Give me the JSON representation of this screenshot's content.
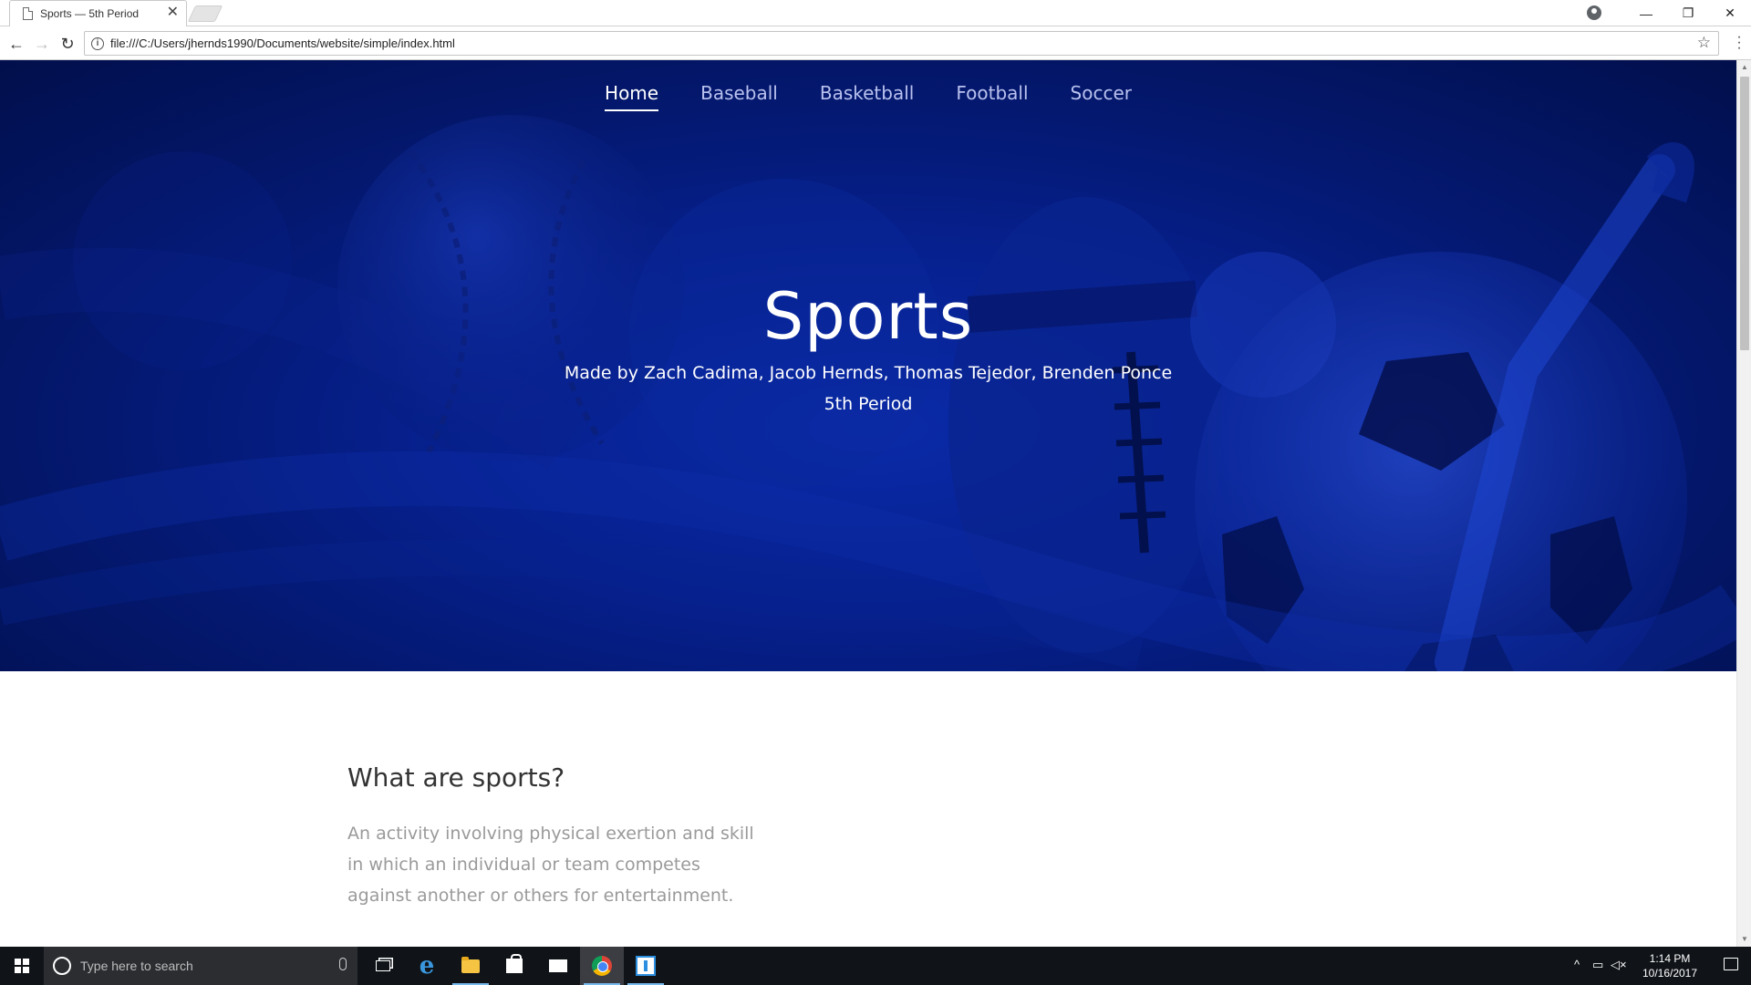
{
  "browser": {
    "tab_title": "Sports — 5th Period",
    "tab_close": "✕",
    "url": "file:///C:/Users/jhernds1990/Documents/website/simple/index.html",
    "window_controls": {
      "minimize": "—",
      "restore": "❐",
      "close": "✕"
    }
  },
  "site": {
    "nav": [
      {
        "label": "Home",
        "active": true
      },
      {
        "label": "Baseball"
      },
      {
        "label": "Basketball"
      },
      {
        "label": "Football"
      },
      {
        "label": "Soccer"
      }
    ],
    "hero": {
      "title": "Sports",
      "subtitle_line1": "Made by Zach Cadima, Jacob Hernds, Thomas Tejedor, Brenden Ponce",
      "subtitle_line2": "5th Period"
    },
    "section": {
      "heading": "What are sports?",
      "body": "An activity involving physical exertion and skill in which an individual or team competes against another or others for entertainment."
    }
  },
  "taskbar": {
    "search_placeholder": "Type here to search",
    "time": "1:14 PM",
    "date": "10/16/2017",
    "edge_glyph": "e"
  },
  "colors": {
    "hero_base": "#06208e",
    "hero_dark": "#020f4c",
    "nav_inactive": "#b9c1ee",
    "body_text": "#9a9a9a"
  }
}
